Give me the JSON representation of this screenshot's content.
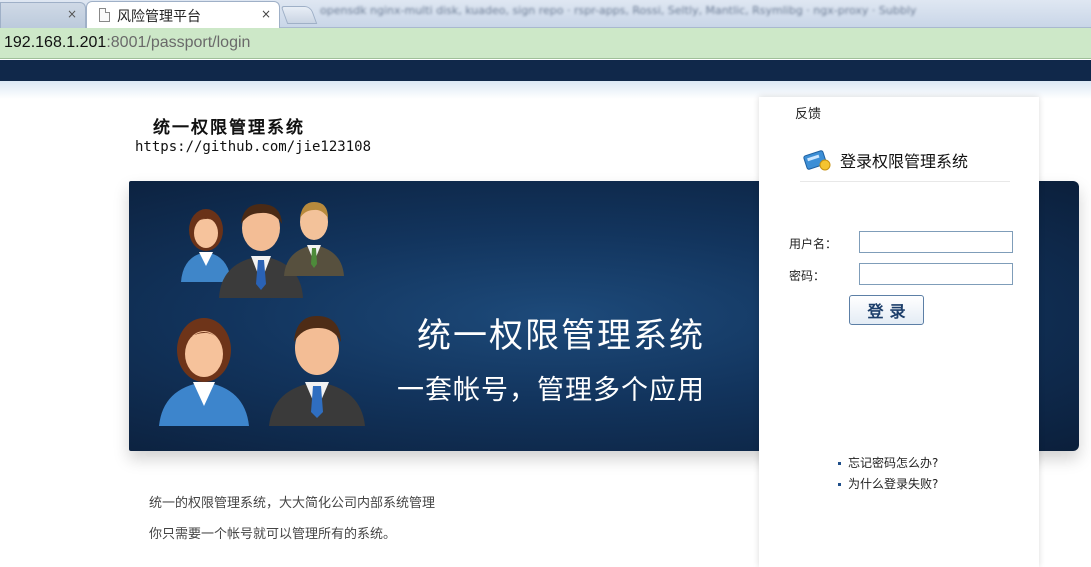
{
  "browser": {
    "active_tab_title": "风险管理平台",
    "close_glyph": "×",
    "blurred_tab_text": "opensdk nginx-multi disk, kuadeo, sign repo · rspr-apps, Rossi, Seltly, Mantlic, Rsymlibg · ngx-proxy · Subbly",
    "url_host": "192.168.1.201",
    "url_rest": ":8001/passport/login"
  },
  "brand": {
    "title": "统一权限管理系统",
    "link": "https://github.com/jie123108"
  },
  "banner": {
    "line1": "统一权限管理系统",
    "line2": "一套帐号，管理多个应用"
  },
  "description": {
    "line1": "统一的权限管理系统，大大简化公司内部系统管理",
    "line2": "你只需要一个帐号就可以管理所有的系统。"
  },
  "login": {
    "feedback": "反馈",
    "title": "登录权限管理系统",
    "username_label": "用户名：",
    "password_label": "密码：",
    "username_value": "",
    "password_value": "",
    "submit_label": "登录",
    "help_forgot": "忘记密码怎么办?",
    "help_failed": "为什么登录失败?"
  },
  "colors": {
    "nav_band": "#10284a",
    "banner": "#12345d",
    "address_bar": "#cde8c8",
    "button_text": "#1c3e6a"
  },
  "icons": {
    "tab_doc": "document-icon",
    "login": "login-card-icon"
  }
}
